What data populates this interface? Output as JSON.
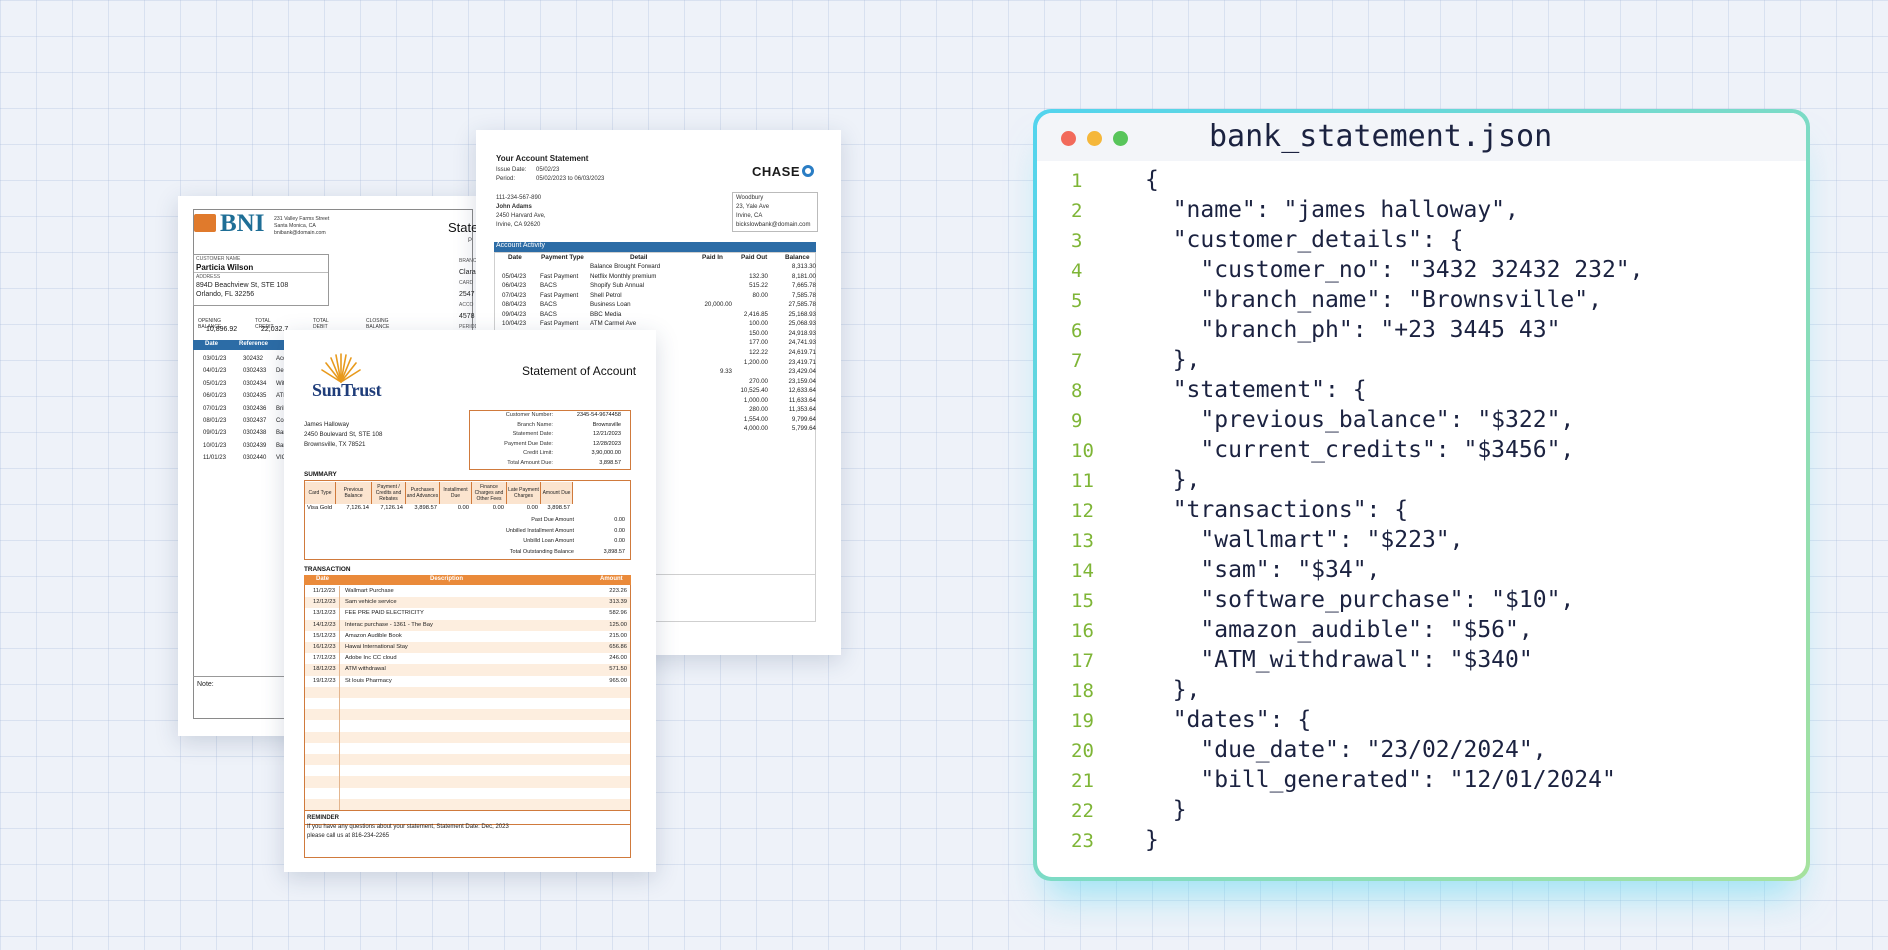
{
  "bni": {
    "logo": "BNI",
    "address": [
      "231 Valley Farms Street",
      "Santa Monica, CA",
      "bnibank@domain.com"
    ],
    "title": "Statement",
    "title_sub": "P",
    "customer_name_label": "CUSTOMER NAME",
    "customer_name": "Particia Wilson",
    "address_label": "ADDRESS",
    "customer_address": [
      "894D Beachview St, STE 108",
      "Orlando, FL 32256"
    ],
    "right_labels": [
      "BRANCH",
      "Clarad",
      "CARD",
      "2547",
      "ACCO",
      "4578",
      "PERIOD"
    ],
    "summary": {
      "headers": [
        "OPENING BALANCE",
        "TOTAL CREDIT",
        "TOTAL DEBIT",
        "CLOSING BALANCE"
      ],
      "values": [
        "10,896.92",
        "22,032.7",
        "",
        ""
      ]
    },
    "table_headers": [
      "Date",
      "Reference"
    ],
    "rows": [
      {
        "date": "03/01/23",
        "ref": "302432",
        "desc": "Acc"
      },
      {
        "date": "04/01/23",
        "ref": "0302433",
        "desc": "Dep"
      },
      {
        "date": "05/01/23",
        "ref": "0302434",
        "desc": "Wit"
      },
      {
        "date": "06/01/23",
        "ref": "0302435",
        "desc": "ATM"
      },
      {
        "date": "07/01/23",
        "ref": "0302436",
        "desc": "Brib"
      },
      {
        "date": "08/01/23",
        "ref": "0302437",
        "desc": "Coa"
      },
      {
        "date": "09/01/23",
        "ref": "0302438",
        "desc": "Bar"
      },
      {
        "date": "10/01/23",
        "ref": "0302439",
        "desc": "Bar"
      },
      {
        "date": "11/01/23",
        "ref": "0302440",
        "desc": "VIC"
      }
    ],
    "note_label": "Note:"
  },
  "chase": {
    "title": "Your Account Statement",
    "issue_label": "Issue Date:",
    "issue_date": "05/02/23",
    "period_label": "Period:",
    "period": "05/02/2023 to 06/03/2023",
    "logo": "CHASE",
    "customer": [
      "111-234-567-890",
      "John Adams",
      "2450 Harvard Ave,",
      "Irvine, CA 92620"
    ],
    "branch": [
      "Woodbury",
      "23, Yale Ave",
      "Irvine, CA",
      "bickslowbank@domain.com"
    ],
    "activity_label": "Account Activity",
    "headers": [
      "Date",
      "Payment Type",
      "Detail",
      "Paid In",
      "Paid Out",
      "Balance"
    ],
    "rows": [
      {
        "date": "",
        "type": "",
        "detail": "Balance Brought Forward",
        "in": "",
        "out": "",
        "bal": "8,313.30"
      },
      {
        "date": "05/04/23",
        "type": "Fast Payment",
        "detail": "Netflix Monthly premium",
        "in": "",
        "out": "132.30",
        "bal": "8,181.00"
      },
      {
        "date": "06/04/23",
        "type": "BACS",
        "detail": "Shopify Sub Annual",
        "in": "",
        "out": "515.22",
        "bal": "7,665.78"
      },
      {
        "date": "07/04/23",
        "type": "Fast Payment",
        "detail": "Shell Petrol",
        "in": "",
        "out": "80.00",
        "bal": "7,585.78"
      },
      {
        "date": "08/04/23",
        "type": "BACS",
        "detail": "Business Loan",
        "in": "20,000.00",
        "out": "",
        "bal": "27,585.78"
      },
      {
        "date": "09/04/23",
        "type": "BACS",
        "detail": "BBC Media",
        "in": "",
        "out": "2,416.85",
        "bal": "25,168.93"
      },
      {
        "date": "10/04/23",
        "type": "Fast Payment",
        "detail": "ATM Carmel Ave",
        "in": "",
        "out": "100.00",
        "bal": "25,068.93"
      },
      {
        "date": "",
        "type": "",
        "detail": "",
        "in": "",
        "out": "150.00",
        "bal": "24,918.93"
      },
      {
        "date": "",
        "type": "",
        "detail": "",
        "in": "",
        "out": "177.00",
        "bal": "24,741.93"
      },
      {
        "date": "",
        "type": "",
        "detail": "",
        "in": "",
        "out": "122.22",
        "bal": "24,619.71"
      },
      {
        "date": "",
        "type": "",
        "detail": "",
        "in": "",
        "out": "1,200.00",
        "bal": "23,419.71"
      },
      {
        "date": "",
        "type": "",
        "detail": "",
        "in": "9.33",
        "out": "",
        "bal": "23,429.04"
      },
      {
        "date": "",
        "type": "",
        "detail": "ice",
        "in": "",
        "out": "270.00",
        "bal": "23,159.04"
      },
      {
        "date": "",
        "type": "",
        "detail": "",
        "in": "",
        "out": "10,525.40",
        "bal": "12,633.64"
      },
      {
        "date": "",
        "type": "",
        "detail": "",
        "in": "",
        "out": "1,000.00",
        "bal": "11,633.64"
      },
      {
        "date": "",
        "type": "",
        "detail": "",
        "in": "",
        "out": "280.00",
        "bal": "11,353.64"
      },
      {
        "date": "",
        "type": "",
        "detail": "",
        "in": "",
        "out": "1,554.00",
        "bal": "9,799.64"
      },
      {
        "date": "",
        "type": "",
        "detail": "",
        "in": "",
        "out": "4,000.00",
        "bal": "5,799.64"
      }
    ]
  },
  "suntrust": {
    "logo": "SunTrust",
    "title": "Statement of Account",
    "info": [
      {
        "k": "Customer Number:",
        "v": "2345-54-9674458"
      },
      {
        "k": "Branch Name:",
        "v": "Brownsville"
      },
      {
        "k": "Statement Date:",
        "v": "12/21/2023"
      },
      {
        "k": "Payment Due Date:",
        "v": "12/28/2023"
      },
      {
        "k": "Credit Limit:",
        "v": "3,90,000.00"
      },
      {
        "k": "Total Amount Due:",
        "v": "3,898.57"
      }
    ],
    "address": [
      "James Halloway",
      "2450 Boulevard St, STE 108",
      "Brownsville, TX 78521"
    ],
    "summary_label": "SUMMARY",
    "summary_headers": [
      "Card Type",
      "Previous Balance",
      "Payment / Credits and Rebates",
      "Purchases and Advances",
      "Installment Due",
      "Finance Charges and Other Fees",
      "Late Payment Charges",
      "Amount Due"
    ],
    "summary_values": [
      "Visa Gold",
      "7,126.14",
      "7,126.14",
      "3,898.57",
      "0.00",
      "0.00",
      "0.00",
      "3,898.57"
    ],
    "totals": [
      {
        "k": "Past Due Amount",
        "v": "0.00"
      },
      {
        "k": "Unbilled Installment Amount",
        "v": "0.00"
      },
      {
        "k": "Unbilld Loan Amount",
        "v": "0.00"
      },
      {
        "k": "Total Outstanding Balance",
        "v": "3,898.57"
      }
    ],
    "transaction_label": "TRANSACTION",
    "transaction_headers": [
      "Date",
      "Description",
      "Amount"
    ],
    "transactions": [
      {
        "date": "11/12/23",
        "desc": "Wallmart Purchase",
        "amount": "223.26"
      },
      {
        "date": "12/12/23",
        "desc": "Sam vehicle service",
        "amount": "313.39"
      },
      {
        "date": "13/12/23",
        "desc": "FEE PRE PAID ELECTRICITY",
        "amount": "582.96"
      },
      {
        "date": "14/12/23",
        "desc": "Interac purchase - 1361 - The Bay",
        "amount": "125.00"
      },
      {
        "date": "15/12/23",
        "desc": "Amazon Audible Book",
        "amount": "215.00"
      },
      {
        "date": "16/12/23",
        "desc": "Hawai International Stay",
        "amount": "656.86"
      },
      {
        "date": "17/12/23",
        "desc": "Adobe Inc CC cloud",
        "amount": "246.00"
      },
      {
        "date": "18/12/23",
        "desc": "ATM withdrawal",
        "amount": "571.50"
      },
      {
        "date": "19/12/23",
        "desc": "St louis Pharmacy",
        "amount": "965.00"
      }
    ],
    "reminder_label": "REMINDER",
    "reminder_text": [
      "If you have any questions about your statement, Statement Date: Dec, 2023",
      "please call us at 816-234-2265"
    ]
  },
  "json_window": {
    "filename": "bank_statement.json",
    "dot_colors": [
      "#f26a5b",
      "#f5b73b",
      "#58c55b"
    ],
    "lines": [
      "{",
      "  \"name\": \"james halloway\",",
      "  \"customer_details\": {",
      "    \"customer_no\": \"3432 32432 232\",",
      "    \"branch_name\": \"Brownsville\",",
      "    \"branch_ph\": \"+23 3445 43\"",
      "  },",
      "  \"statement\": {",
      "    \"previous_balance\": \"$322\",",
      "    \"current_credits\": \"$3456\",",
      "  },",
      "  \"transactions\": {",
      "    \"wallmart\": \"$223\",",
      "    \"sam\": \"$34\",",
      "    \"software_purchase\": \"$10\",",
      "    \"amazon_audible\": \"$56\",",
      "    \"ATM_withdrawal\": \"$340\"",
      "  },",
      "  \"dates\": {",
      "    \"due_date\": \"23/02/2024\",",
      "    \"bill_generated\": \"12/01/2024\"",
      "  }",
      "}"
    ]
  }
}
